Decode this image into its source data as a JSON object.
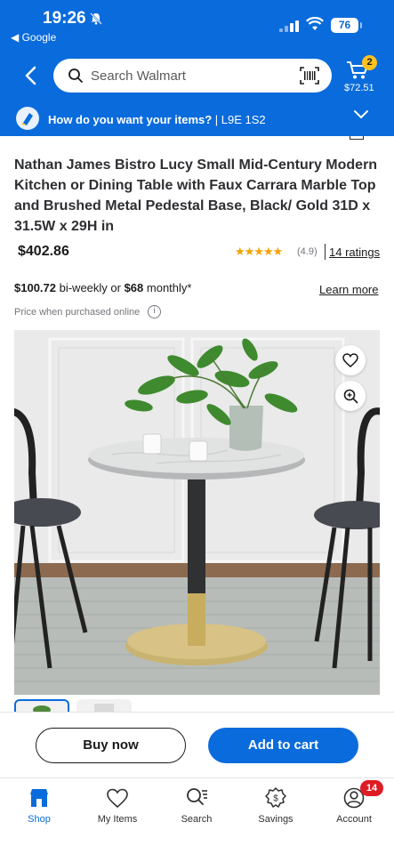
{
  "status_bar": {
    "time": "19:26",
    "back_app": "◀ Google",
    "battery": "76"
  },
  "header": {
    "search_placeholder": "Search Walmart",
    "cart_count": "2",
    "cart_total": "$72.51",
    "delivery_question": "How do you want your items?",
    "delivery_postal": " | L9E 1S2",
    "brand_color": "#0a6bdc",
    "cart_badge_color": "#ffc220"
  },
  "product": {
    "title": "Nathan James Bistro Lucy Small Mid-Century Modern Kitchen or Dining Table with Faux Carrara Marble Top and Brushed Metal Pedestal Base, Black/ Gold 31D x 31.5W x 29H in",
    "price": "$402.86",
    "stars": "★★★★★",
    "rating_value": "(4.9)",
    "ratings_link": "14 ratings",
    "finance_biweekly": "$100.72",
    "finance_mid": " bi-weekly or ",
    "finance_monthly": "$68",
    "finance_end": " monthly*",
    "learn_more": "Learn more",
    "price_note": "Price when purchased online",
    "info_glyph": "i"
  },
  "actions": {
    "buy_now": "Buy now",
    "add_to_cart": "Add to cart"
  },
  "tabbar": {
    "tabs": [
      {
        "label": "Shop",
        "icon": "shop-icon"
      },
      {
        "label": "My Items",
        "icon": "heart-icon"
      },
      {
        "label": "Search",
        "icon": "search-icon"
      },
      {
        "label": "Savings",
        "icon": "savings-icon"
      },
      {
        "label": "Account",
        "icon": "account-icon"
      }
    ],
    "account_badge": "14",
    "badge_color": "#de1c24"
  }
}
